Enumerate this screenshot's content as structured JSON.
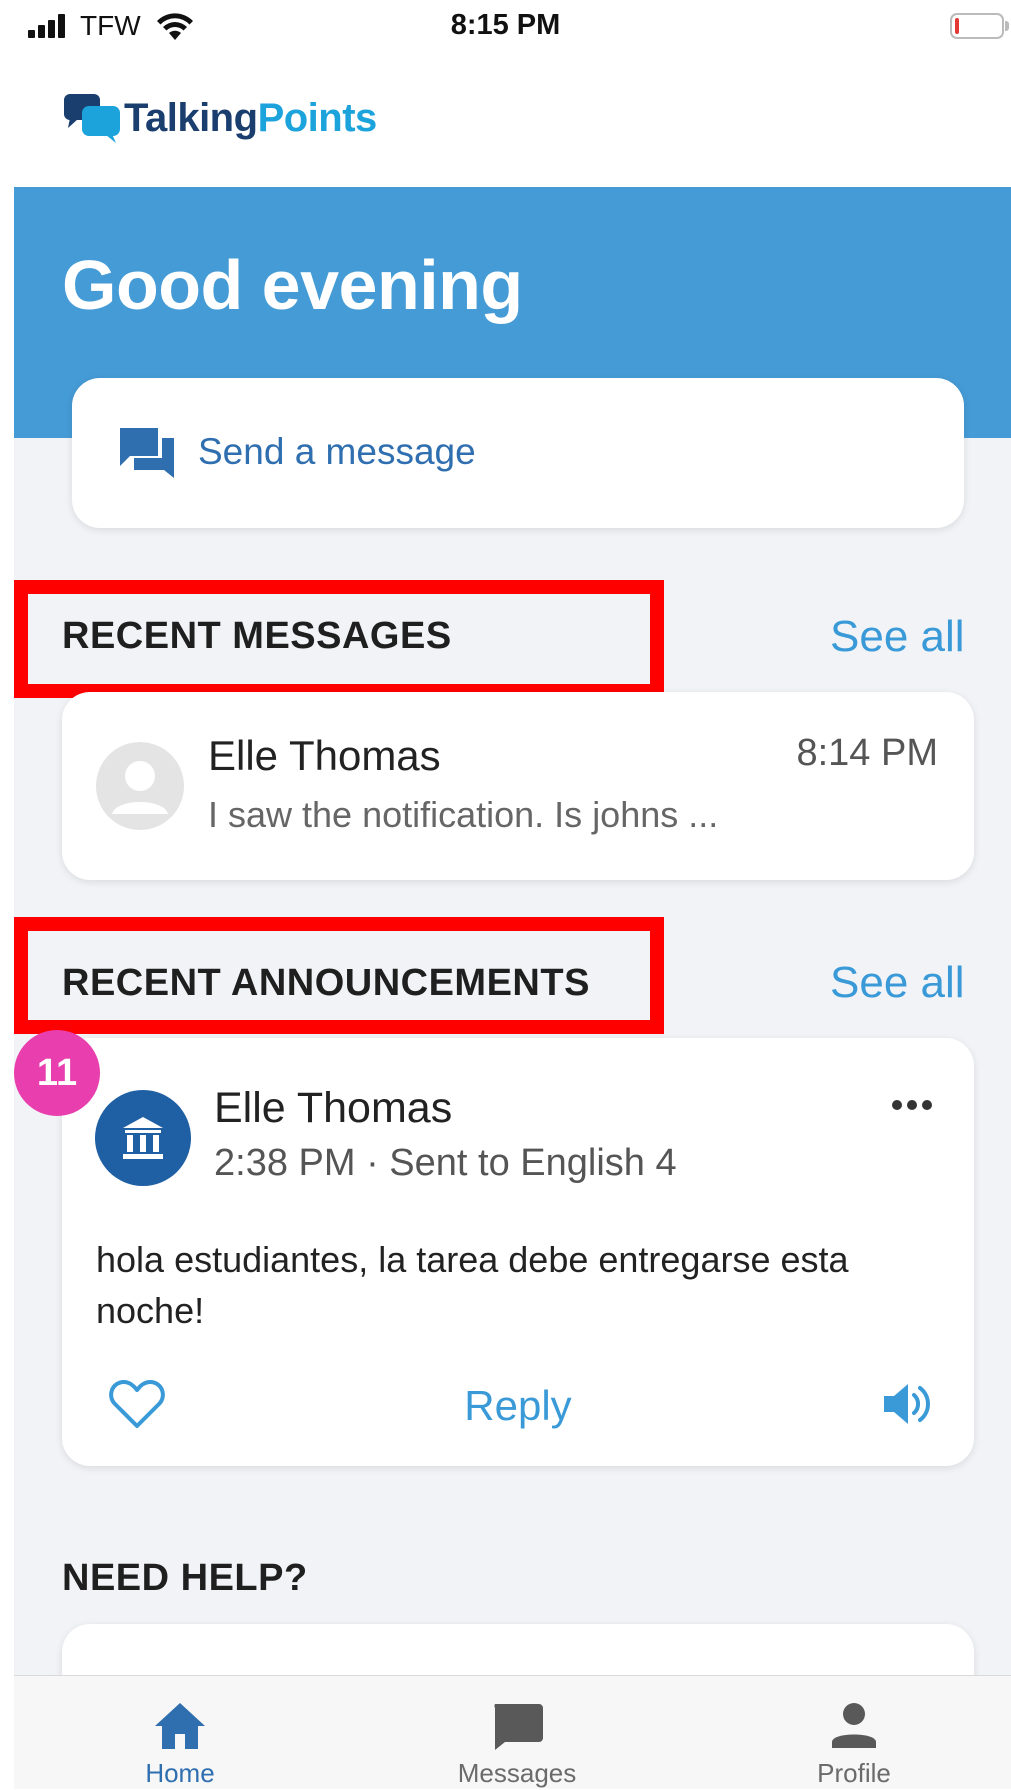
{
  "status_bar": {
    "carrier": "TFW",
    "time": "8:15 PM"
  },
  "logo": {
    "part1": "Talking",
    "part2": "Points"
  },
  "hero": {
    "greeting": "Good evening"
  },
  "send_message": {
    "label": "Send a message"
  },
  "recent_messages": {
    "title": "RECENT MESSAGES",
    "see_all": "See all",
    "items": [
      {
        "name": "Elle Thomas",
        "time": "8:14 PM",
        "preview": "I saw the notification. Is johns ..."
      }
    ]
  },
  "recent_announcements": {
    "title": "RECENT ANNOUNCEMENTS",
    "see_all": "See all",
    "badge": "11",
    "items": [
      {
        "name": "Elle Thomas",
        "meta": "2:38 PM · Sent to English 4",
        "body": "hola estudiantes, la tarea debe entregarse esta noche!",
        "reply": "Reply"
      }
    ]
  },
  "help": {
    "title": "NEED HELP?"
  },
  "bottom_nav": {
    "items": [
      {
        "label": "Home",
        "icon": "home-icon",
        "active": true
      },
      {
        "label": "Messages",
        "icon": "messages-icon",
        "active": false
      },
      {
        "label": "Profile",
        "icon": "profile-icon",
        "active": false
      }
    ]
  },
  "colors": {
    "hero": "#459bd6",
    "accent": "#3a9ad8",
    "highlight": "#ff0000",
    "badge": "#e83eae",
    "nav_active": "#2f6fb0",
    "nav_inactive": "#6b6b6b"
  }
}
